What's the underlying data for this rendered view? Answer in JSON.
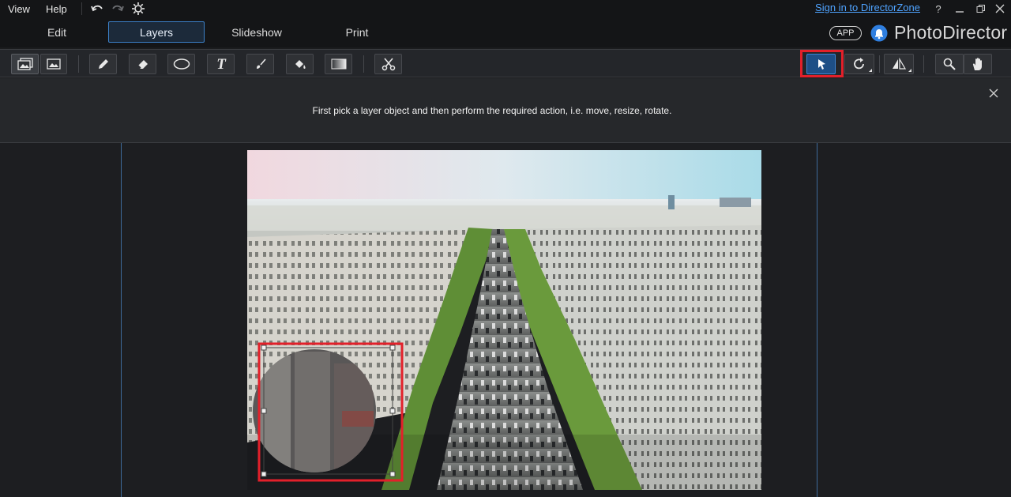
{
  "menu": {
    "view": "View",
    "help": "Help"
  },
  "topbar": {
    "sign_in": "Sign in to DirectorZone",
    "help": "?"
  },
  "tabs": [
    {
      "label": "Edit"
    },
    {
      "label": "Layers"
    },
    {
      "label": "Slideshow"
    },
    {
      "label": "Print"
    }
  ],
  "active_tab": "Layers",
  "app_badge": "APP",
  "brand": "PhotoDirector",
  "hint": "First pick a layer object and then perform the required action, i.e. move, resize, rotate.",
  "colors": {
    "accent": "#3b80c8",
    "highlight": "#e3202a",
    "link": "#4fa3ff"
  },
  "icons": {
    "toolbar_left": [
      "layers-view-icon",
      "photo-view-icon",
      "pencil-icon",
      "eraser-icon",
      "ellipse-icon",
      "text-icon",
      "brush-icon",
      "fill-bucket-icon",
      "gradient-icon",
      "scissors-icon"
    ],
    "toolbar_right": [
      "select-arrow-icon",
      "rotate-icon",
      "flip-icon",
      "zoom-icon",
      "pan-hand-icon"
    ]
  }
}
